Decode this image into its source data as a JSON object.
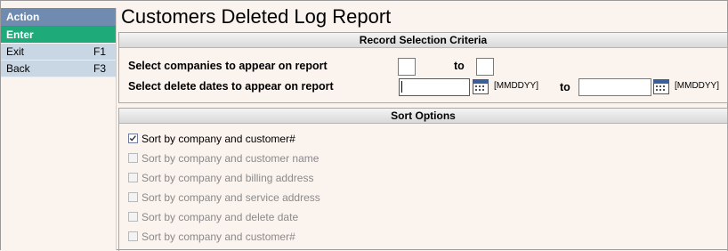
{
  "sidebar": {
    "header": "Action",
    "items": [
      {
        "label": "Enter",
        "key": ""
      },
      {
        "label": "Exit",
        "key": "F1"
      },
      {
        "label": "Back",
        "key": "F3"
      }
    ]
  },
  "page": {
    "title": "Customers Deleted Log Report"
  },
  "selection": {
    "heading": "Record Selection Criteria",
    "companies_label": "Select companies to appear on report",
    "companies_to": "to",
    "dates_label": "Select delete dates to appear on report",
    "dates_to": "to",
    "date_format_from": "[MMDDYY]",
    "date_format_to": "[MMDDYY]",
    "company_from": "",
    "company_to": "",
    "date_from": "",
    "date_to": ""
  },
  "sort": {
    "heading": "Sort Options",
    "options": [
      {
        "label": "Sort by company and customer#",
        "checked": true,
        "enabled": true
      },
      {
        "label": "Sort by company and customer name",
        "checked": false,
        "enabled": false
      },
      {
        "label": "Sort by company and billing address",
        "checked": false,
        "enabled": false
      },
      {
        "label": "Sort by company and service address",
        "checked": false,
        "enabled": false
      },
      {
        "label": "Sort by company and delete date",
        "checked": false,
        "enabled": false
      },
      {
        "label": "Sort by company and customer#",
        "checked": false,
        "enabled": false
      }
    ]
  },
  "colors": {
    "sidebar_header": "#6f8cb0",
    "active_item": "#1faa7a",
    "sidebar_item": "#c9d6e3",
    "background": "#fbf3ee"
  }
}
